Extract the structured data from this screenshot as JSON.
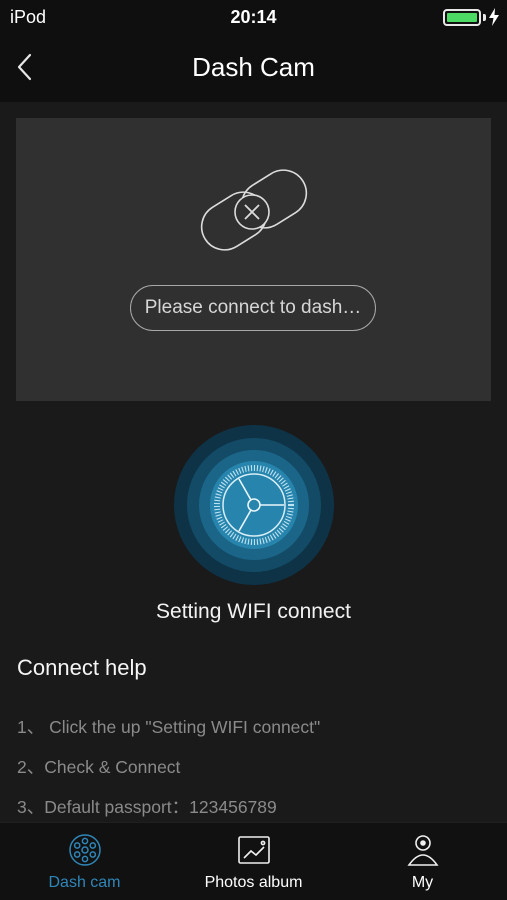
{
  "status_bar": {
    "carrier": "iPod",
    "time": "20:14",
    "battery_level": 1.0,
    "battery_color": "#4cd964",
    "charging": true
  },
  "nav": {
    "title": "Dash Cam",
    "back_icon": "chevron-left-icon"
  },
  "camera_panel": {
    "icon": "disconnected-link-icon",
    "hint": "Please connect to dash…"
  },
  "wifi_connect": {
    "icon": "wifi-dial-icon",
    "label": "Setting WIFI connect",
    "accent": "#1f7da6"
  },
  "help": {
    "title": "Connect help",
    "steps": [
      "1、 Click the up \"Setting WIFI connect\"",
      "2、Check & Connect",
      "3、Default passport：123456789"
    ]
  },
  "tab_bar": {
    "active_color": "#2f86b8",
    "tabs": [
      {
        "label": "Dash cam",
        "icon": "dash-cam-icon",
        "active": true
      },
      {
        "label": "Photos album",
        "icon": "photo-album-icon",
        "active": false
      },
      {
        "label": "My",
        "icon": "user-icon",
        "active": false
      }
    ]
  }
}
